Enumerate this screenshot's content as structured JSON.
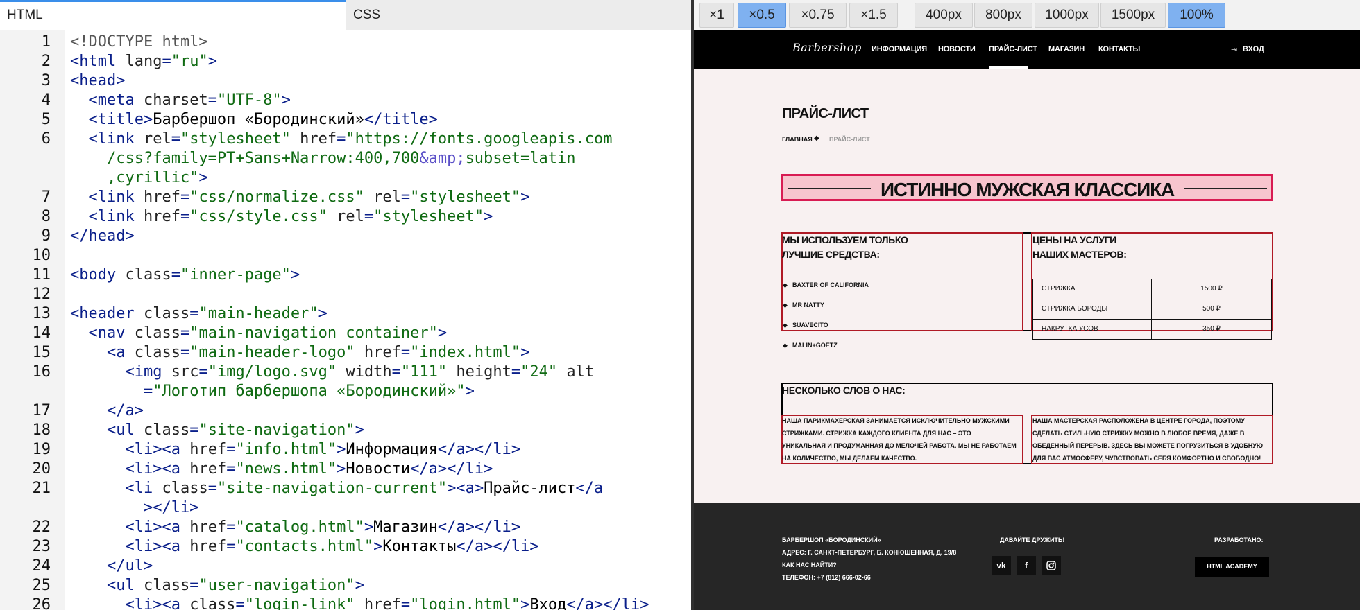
{
  "editor": {
    "tabs": {
      "html": "HTML",
      "css": "CSS"
    },
    "lines": [
      {
        "n": "1",
        "parts": [
          [
            "doc",
            "<!DOCTYPE html>"
          ]
        ]
      },
      {
        "n": "2",
        "parts": [
          [
            "tag",
            "<html "
          ],
          [
            "attr",
            "lang"
          ],
          [
            "tag",
            "="
          ],
          [
            "str",
            "\"ru\""
          ],
          [
            "tag",
            ">"
          ]
        ]
      },
      {
        "n": "3",
        "parts": [
          [
            "tag",
            "<head>"
          ]
        ]
      },
      {
        "n": "4",
        "parts": [
          [
            "txt",
            "  "
          ],
          [
            "tag",
            "<meta "
          ],
          [
            "attr",
            "charset"
          ],
          [
            "tag",
            "="
          ],
          [
            "str",
            "\"UTF-8\""
          ],
          [
            "tag",
            ">"
          ]
        ]
      },
      {
        "n": "5",
        "parts": [
          [
            "txt",
            "  "
          ],
          [
            "tag",
            "<title>"
          ],
          [
            "txt",
            "Барбершоп «Бородинский»"
          ],
          [
            "tag",
            "</title>"
          ]
        ]
      },
      {
        "n": "6",
        "parts": [
          [
            "txt",
            "  "
          ],
          [
            "tag",
            "<link "
          ],
          [
            "attr",
            "rel"
          ],
          [
            "tag",
            "="
          ],
          [
            "str",
            "\"stylesheet\""
          ],
          [
            "attr",
            " href"
          ],
          [
            "tag",
            "="
          ],
          [
            "str",
            "\"https://fonts.googleapis.com"
          ]
        ]
      },
      {
        "n": "",
        "parts": [
          [
            "str",
            "    /css?family=PT+Sans+Narrow:400,700"
          ],
          [
            "ent",
            "&amp;"
          ],
          [
            "str",
            "subset=latin"
          ]
        ]
      },
      {
        "n": "",
        "parts": [
          [
            "str",
            "    ,cyrillic\""
          ],
          [
            "tag",
            ">"
          ]
        ]
      },
      {
        "n": "7",
        "parts": [
          [
            "txt",
            "  "
          ],
          [
            "tag",
            "<link "
          ],
          [
            "attr",
            "href"
          ],
          [
            "tag",
            "="
          ],
          [
            "str",
            "\"css/normalize.css\""
          ],
          [
            "attr",
            " rel"
          ],
          [
            "tag",
            "="
          ],
          [
            "str",
            "\"stylesheet\""
          ],
          [
            "tag",
            ">"
          ]
        ]
      },
      {
        "n": "8",
        "parts": [
          [
            "txt",
            "  "
          ],
          [
            "tag",
            "<link "
          ],
          [
            "attr",
            "href"
          ],
          [
            "tag",
            "="
          ],
          [
            "str",
            "\"css/style.css\""
          ],
          [
            "attr",
            " rel"
          ],
          [
            "tag",
            "="
          ],
          [
            "str",
            "\"stylesheet\""
          ],
          [
            "tag",
            ">"
          ]
        ]
      },
      {
        "n": "9",
        "parts": [
          [
            "tag",
            "</head>"
          ]
        ]
      },
      {
        "n": "10",
        "parts": []
      },
      {
        "n": "11",
        "parts": [
          [
            "tag",
            "<body "
          ],
          [
            "attr",
            "class"
          ],
          [
            "tag",
            "="
          ],
          [
            "str",
            "\"inner-page\""
          ],
          [
            "tag",
            ">"
          ]
        ]
      },
      {
        "n": "12",
        "parts": []
      },
      {
        "n": "13",
        "parts": [
          [
            "tag",
            "<header "
          ],
          [
            "attr",
            "class"
          ],
          [
            "tag",
            "="
          ],
          [
            "str",
            "\"main-header\""
          ],
          [
            "tag",
            ">"
          ]
        ]
      },
      {
        "n": "14",
        "parts": [
          [
            "txt",
            "  "
          ],
          [
            "tag",
            "<nav "
          ],
          [
            "attr",
            "class"
          ],
          [
            "tag",
            "="
          ],
          [
            "str",
            "\"main-navigation container\""
          ],
          [
            "tag",
            ">"
          ]
        ]
      },
      {
        "n": "15",
        "parts": [
          [
            "txt",
            "    "
          ],
          [
            "tag",
            "<a "
          ],
          [
            "attr",
            "class"
          ],
          [
            "tag",
            "="
          ],
          [
            "str",
            "\"main-header-logo\""
          ],
          [
            "attr",
            " href"
          ],
          [
            "tag",
            "="
          ],
          [
            "str",
            "\"index.html\""
          ],
          [
            "tag",
            ">"
          ]
        ]
      },
      {
        "n": "16",
        "parts": [
          [
            "txt",
            "      "
          ],
          [
            "tag",
            "<img "
          ],
          [
            "attr",
            "src"
          ],
          [
            "tag",
            "="
          ],
          [
            "str",
            "\"img/logo.svg\""
          ],
          [
            "attr",
            " width"
          ],
          [
            "tag",
            "="
          ],
          [
            "str",
            "\"111\""
          ],
          [
            "attr",
            " height"
          ],
          [
            "tag",
            "="
          ],
          [
            "str",
            "\"24\""
          ],
          [
            "attr",
            " alt"
          ]
        ]
      },
      {
        "n": "",
        "parts": [
          [
            "tag",
            "        ="
          ],
          [
            "str",
            "\"Логотип барбершопа «Бородинский»\""
          ],
          [
            "tag",
            ">"
          ]
        ]
      },
      {
        "n": "17",
        "parts": [
          [
            "txt",
            "    "
          ],
          [
            "tag",
            "</a>"
          ]
        ]
      },
      {
        "n": "18",
        "parts": [
          [
            "txt",
            "    "
          ],
          [
            "tag",
            "<ul "
          ],
          [
            "attr",
            "class"
          ],
          [
            "tag",
            "="
          ],
          [
            "str",
            "\"site-navigation\""
          ],
          [
            "tag",
            ">"
          ]
        ]
      },
      {
        "n": "19",
        "parts": [
          [
            "txt",
            "      "
          ],
          [
            "tag",
            "<li><a "
          ],
          [
            "attr",
            "href"
          ],
          [
            "tag",
            "="
          ],
          [
            "str",
            "\"info.html\""
          ],
          [
            "tag",
            ">"
          ],
          [
            "txt",
            "Информация"
          ],
          [
            "tag",
            "</a></li>"
          ]
        ]
      },
      {
        "n": "20",
        "parts": [
          [
            "txt",
            "      "
          ],
          [
            "tag",
            "<li><a "
          ],
          [
            "attr",
            "href"
          ],
          [
            "tag",
            "="
          ],
          [
            "str",
            "\"news.html\""
          ],
          [
            "tag",
            ">"
          ],
          [
            "txt",
            "Новости"
          ],
          [
            "tag",
            "</a></li>"
          ]
        ]
      },
      {
        "n": "21",
        "parts": [
          [
            "txt",
            "      "
          ],
          [
            "tag",
            "<li "
          ],
          [
            "attr",
            "class"
          ],
          [
            "tag",
            "="
          ],
          [
            "str",
            "\"site-navigation-current\""
          ],
          [
            "tag",
            ">"
          ],
          [
            "tag",
            "<a>"
          ],
          [
            "txt",
            "Прайс-лист"
          ],
          [
            "tag",
            "</a"
          ]
        ]
      },
      {
        "n": "",
        "parts": [
          [
            "tag",
            "        ></li>"
          ]
        ]
      },
      {
        "n": "22",
        "parts": [
          [
            "txt",
            "      "
          ],
          [
            "tag",
            "<li><a "
          ],
          [
            "attr",
            "href"
          ],
          [
            "tag",
            "="
          ],
          [
            "str",
            "\"catalog.html\""
          ],
          [
            "tag",
            ">"
          ],
          [
            "txt",
            "Магазин"
          ],
          [
            "tag",
            "</a></li>"
          ]
        ]
      },
      {
        "n": "23",
        "parts": [
          [
            "txt",
            "      "
          ],
          [
            "tag",
            "<li><a "
          ],
          [
            "attr",
            "href"
          ],
          [
            "tag",
            "="
          ],
          [
            "str",
            "\"contacts.html\""
          ],
          [
            "tag",
            ">"
          ],
          [
            "txt",
            "Контакты"
          ],
          [
            "tag",
            "</a></li>"
          ]
        ]
      },
      {
        "n": "24",
        "parts": [
          [
            "txt",
            "    "
          ],
          [
            "tag",
            "</ul>"
          ]
        ]
      },
      {
        "n": "25",
        "parts": [
          [
            "txt",
            "    "
          ],
          [
            "tag",
            "<ul "
          ],
          [
            "attr",
            "class"
          ],
          [
            "tag",
            "="
          ],
          [
            "str",
            "\"user-navigation\""
          ],
          [
            "tag",
            ">"
          ]
        ]
      },
      {
        "n": "26",
        "parts": [
          [
            "txt",
            "      "
          ],
          [
            "tag",
            "<li><a "
          ],
          [
            "attr",
            "class"
          ],
          [
            "tag",
            "="
          ],
          [
            "str",
            "\"login-link\""
          ],
          [
            "attr",
            " href"
          ],
          [
            "tag",
            "="
          ],
          [
            "str",
            "\"login.html\""
          ],
          [
            "tag",
            ">"
          ],
          [
            "txt",
            "Вход"
          ],
          [
            "tag",
            "</a></li>"
          ]
        ]
      }
    ]
  },
  "preview": {
    "scale_buttons": [
      "×1",
      "×0.5",
      "×0.75",
      "×1.5"
    ],
    "scale_active": "×0.5",
    "width_buttons": [
      "400px",
      "800px",
      "1000px",
      "1500px",
      "100%"
    ],
    "width_active": "100%",
    "site": {
      "logo": "Barbershop",
      "nav": [
        "ИНФОРМАЦИЯ",
        "НОВОСТИ",
        "ПРАЙС-ЛИСТ",
        "МАГАЗИН",
        "КОНТАКТЫ"
      ],
      "login": "ВХОД",
      "page_title": "ПРАЙС-ЛИСТ",
      "breadcrumb_home": "ГЛАВНАЯ",
      "breadcrumb_current": "ПРАЙС-ЛИСТ",
      "banner": "ИСТИННО МУЖСКАЯ КЛАССИКА",
      "products_heading_1": "МЫ ИСПОЛЬЗУЕМ ТОЛЬКО",
      "products_heading_2": "ЛУЧШИЕ СРЕДСТВА:",
      "products": [
        "BAXTER OF CALIFORNIA",
        "MR NATTY",
        "SUAVECITO",
        "MALIN+GOETZ"
      ],
      "prices_heading_1": "ЦЕНЫ НА УСЛУГИ",
      "prices_heading_2": "НАШИХ МАСТЕРОВ:",
      "prices": [
        {
          "service": "СТРИЖКА",
          "price": "1500 ₽"
        },
        {
          "service": "СТРИЖКА БОРОДЫ",
          "price": "500 ₽"
        },
        {
          "service": "НАКРУТКА УСОВ",
          "price": "350 ₽"
        }
      ],
      "about_heading": "НЕСКОЛЬКО СЛОВ О НАС:",
      "about_left": [
        "НАША ПАРИКМАХЕРСКАЯ ЗАНИМАЕТСЯ ИСКЛЮЧИТЕЛЬНО МУЖСКИМИ",
        "СТРИЖКАМИ. СТРИЖКА КАЖДОГО КЛИЕНТА ДЛЯ НАС – ЭТО",
        "УНИКАЛЬНАЯ И ПРОДУМАННАЯ ДО МЕЛОЧЕЙ РАБОТА. МЫ НЕ РАБОТАЕМ",
        "НА КОЛИЧЕСТВО, МЫ ДЕЛАЕМ КАЧЕСТВО."
      ],
      "about_right": [
        "НАША МАСТЕРСКАЯ РАСПОЛОЖЕНА В ЦЕНТРЕ ГОРОДА, ПОЭТОМУ",
        "СДЕЛАТЬ СТИЛЬНУЮ СТРИЖКУ МОЖНО В ЛЮБОЕ ВРЕМЯ, ДАЖЕ В",
        "ОБЕДЕННЫЙ ПЕРЕРЫВ. ЗДЕСЬ ВЫ МОЖЕТЕ ПОГРУЗИТЬСЯ В УДОБНУЮ",
        "ДЛЯ ВАС АТМОСФЕРУ, ЧУВСТВОВАТЬ СЕБЯ КОМФОРТНО И СВОБОДНО!"
      ],
      "footer_name": "БАРБЕРШОП «БОРОДИНСКИЙ»",
      "footer_address": "АДРЕС: Г. САНКТ-ПЕТЕРБУРГ, Б. КОНЮШЕННАЯ, Д. 19/8",
      "footer_find": "КАК НАС НАЙТИ?",
      "footer_phone": "ТЕЛЕФОН: +7 (812) 666-02-66",
      "footer_friends": "ДАВАЙТЕ ДРУЖИТЬ!",
      "footer_dev": "РАЗРАБОТАНО:",
      "dev_button": "HTML ACADEMY",
      "social": [
        "vk-icon",
        "facebook-icon",
        "instagram-icon"
      ]
    }
  }
}
